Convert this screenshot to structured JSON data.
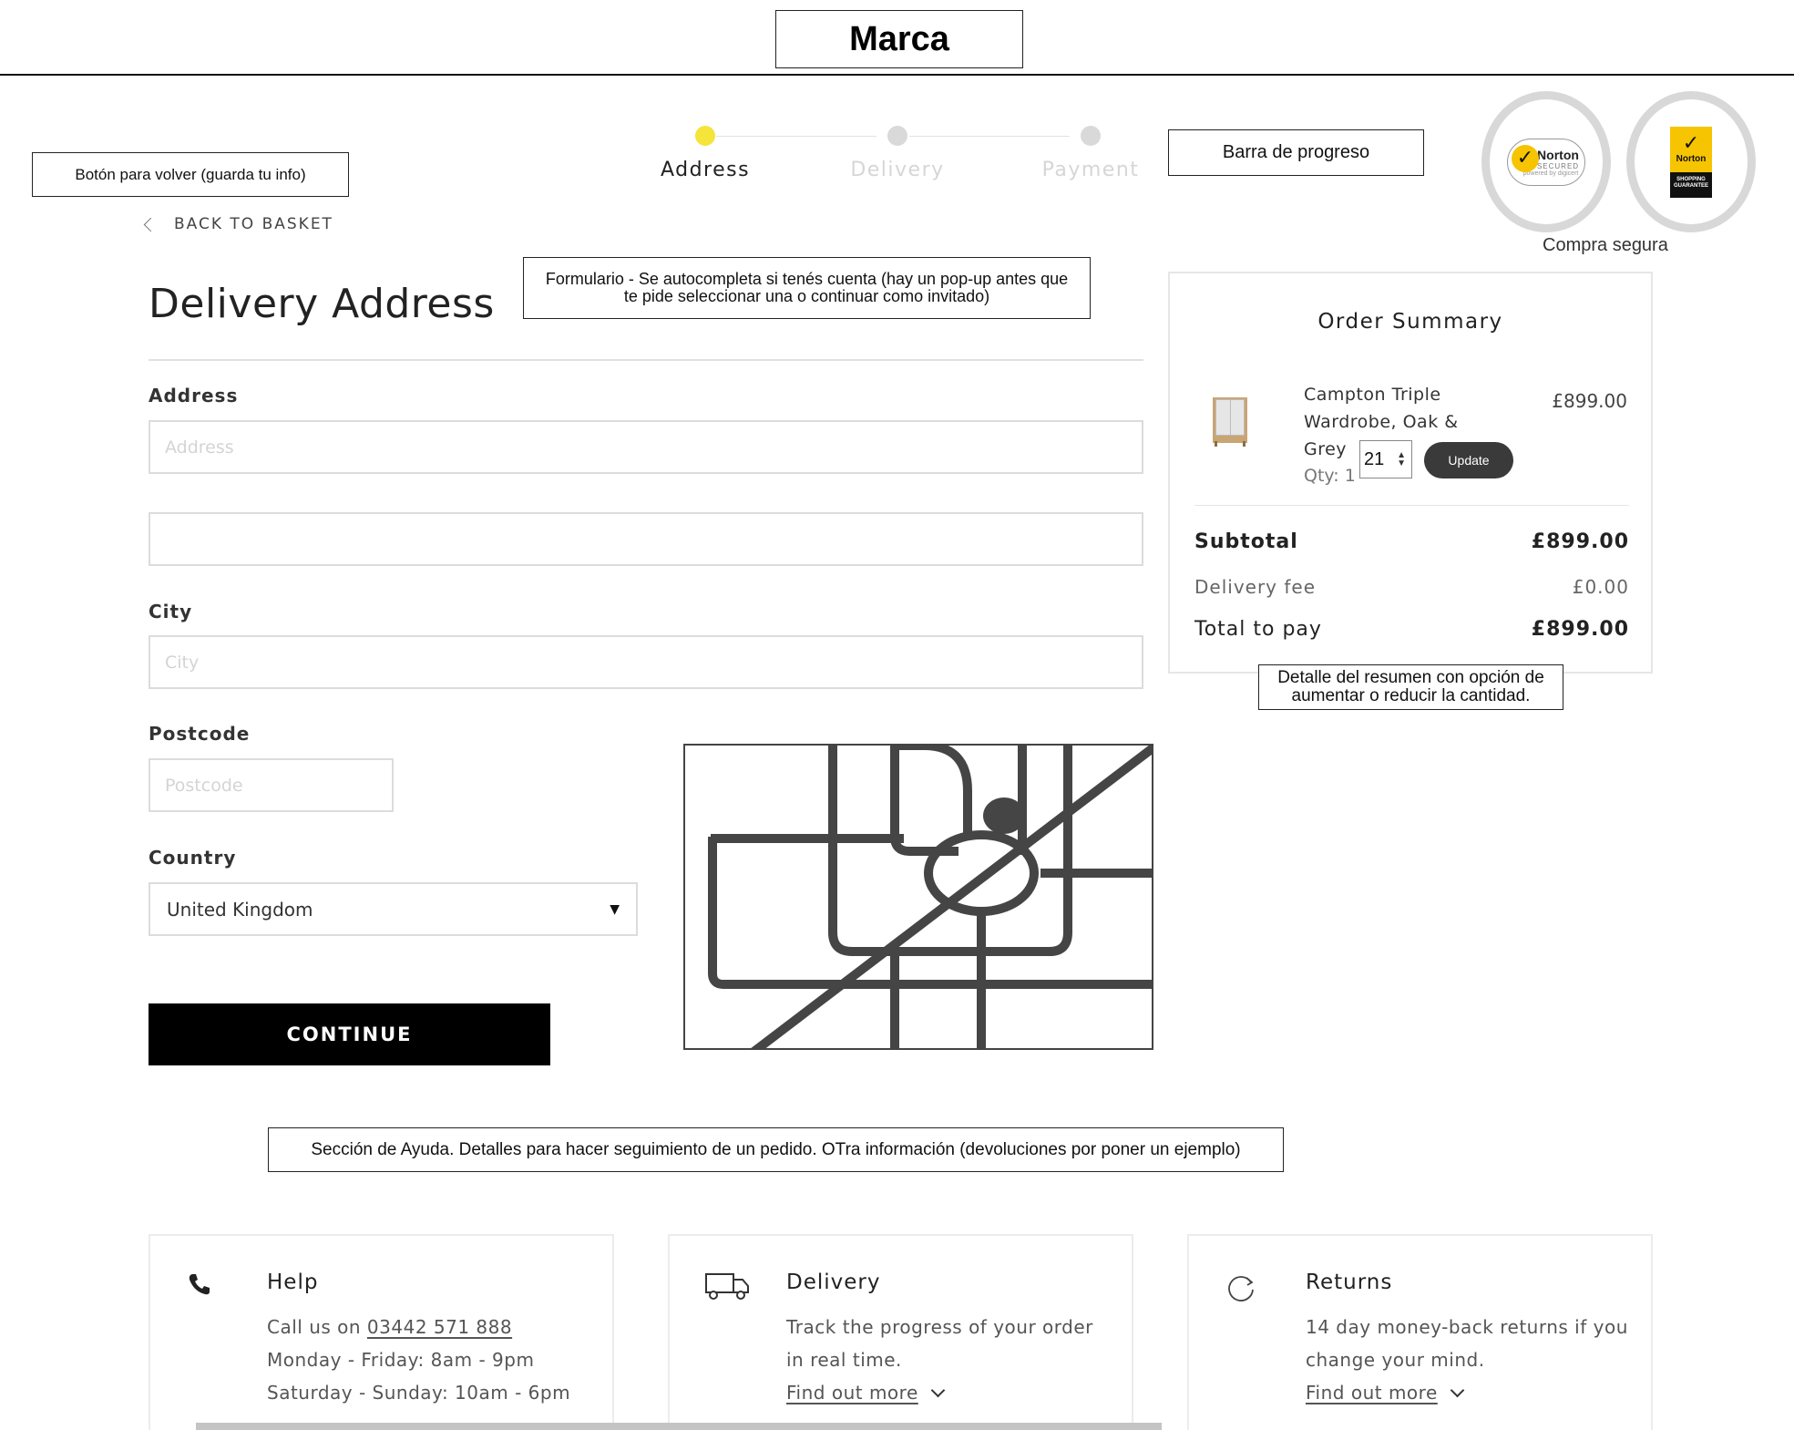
{
  "brand": "Marca",
  "annotations": {
    "back_button": "Botón para volver (guarda tu info)",
    "progress_bar": "Barra de progreso",
    "secure_purchase": "Compra segura",
    "form": "Formulario - Se autocompleta si tenés cuenta (hay un pop-up antes que te pide seleccionar una o continuar como invitado)",
    "summary_detail": "Detalle del resumen con opción de aumentar o reducir la cantidad.",
    "help_section": "Sección de Ayuda. Detalles para hacer seguimiento de un pedido. OTra información (devoluciones por poner un ejemplo)"
  },
  "back_link": "BACK TO BASKET",
  "progress": {
    "steps": [
      {
        "label": "Address",
        "active": true
      },
      {
        "label": "Delivery",
        "active": false
      },
      {
        "label": "Payment",
        "active": false
      }
    ],
    "active_color": "#f5e43a"
  },
  "badges": {
    "secured": {
      "name": "Norton",
      "sub": "SECURED",
      "powered": "powered by digicert"
    },
    "guarantee": {
      "name": "Norton",
      "sub": "SHOPPING GUARANTEE"
    }
  },
  "form": {
    "title": "Delivery Address",
    "address_label": "Address",
    "address_placeholder": "Address",
    "address2_placeholder": "",
    "city_label": "City",
    "city_placeholder": "City",
    "postcode_label": "Postcode",
    "postcode_placeholder": "Postcode",
    "country_label": "Country",
    "country_value": "United Kingdom",
    "continue_label": "CONTINUE"
  },
  "summary": {
    "title": "Order Summary",
    "product_name": "Campton Triple Wardrobe, Oak & Grey",
    "product_qty": "Qty: 1",
    "product_price": "£899.00",
    "qty_value": "21",
    "update_label": "Update",
    "subtotal_label": "Subtotal",
    "subtotal_value": "£899.00",
    "delivery_label": "Delivery fee",
    "delivery_value": "£0.00",
    "total_label": "Total to pay",
    "total_value": "£899.00"
  },
  "help_cards": {
    "help": {
      "title": "Help",
      "body_prefix": "Call us on",
      "phone": "03442 571 888",
      "hours_week": "Monday - Friday: 8am - 9pm",
      "hours_weekend": "Saturday - Sunday: 10am - 6pm"
    },
    "delivery": {
      "title": "Delivery",
      "body": "Track the progress of your order in real time.",
      "link": "Find out more"
    },
    "returns": {
      "title": "Returns",
      "body": "14 day money-back returns if you change your mind.",
      "link": "Find out more"
    }
  },
  "icons": [
    "chevron-left-icon",
    "phone-icon",
    "truck-icon",
    "refresh-icon",
    "chevron-down-icon",
    "map-pin-icon"
  ]
}
